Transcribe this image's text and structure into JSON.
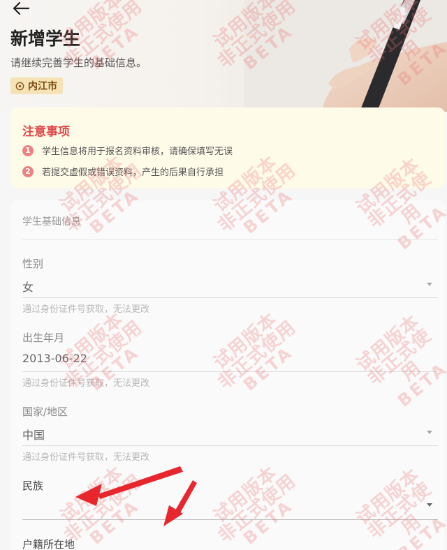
{
  "header": {
    "title": "新增学生",
    "subtitle": "请继续完善学生的基础信息。",
    "location": "内江市"
  },
  "notice": {
    "title": "注意事项",
    "items": [
      {
        "num": "1",
        "text": "学生信息将用于报名资料审核，请确保填写无误"
      },
      {
        "num": "2",
        "text": "若提交虚假或错误资料，产生的后果自行承担"
      }
    ]
  },
  "form": {
    "section_title": "学生基础信息",
    "gender": {
      "label": "性别",
      "value": "女",
      "hint": "通过身份证件号获取，无法更改"
    },
    "birth": {
      "label": "出生年月",
      "value": "2013-06-22",
      "hint": "通过身份证件号获取，无法更改"
    },
    "country": {
      "label": "国家/地区",
      "value": "中国",
      "hint": "通过身份证件号获取，无法更改"
    },
    "ethnicity": {
      "label": "民族",
      "value": ""
    },
    "household": {
      "label": "户籍所在地"
    }
  },
  "watermark": {
    "line1": "试用版本",
    "line2": "非正式使用",
    "line3": "BETA"
  },
  "colors": {
    "accent_red": "#e04848",
    "notice_bg": "#fffbe9",
    "chip_bg": "#f6e3b5",
    "annotation_arrow": "#e8262e"
  }
}
